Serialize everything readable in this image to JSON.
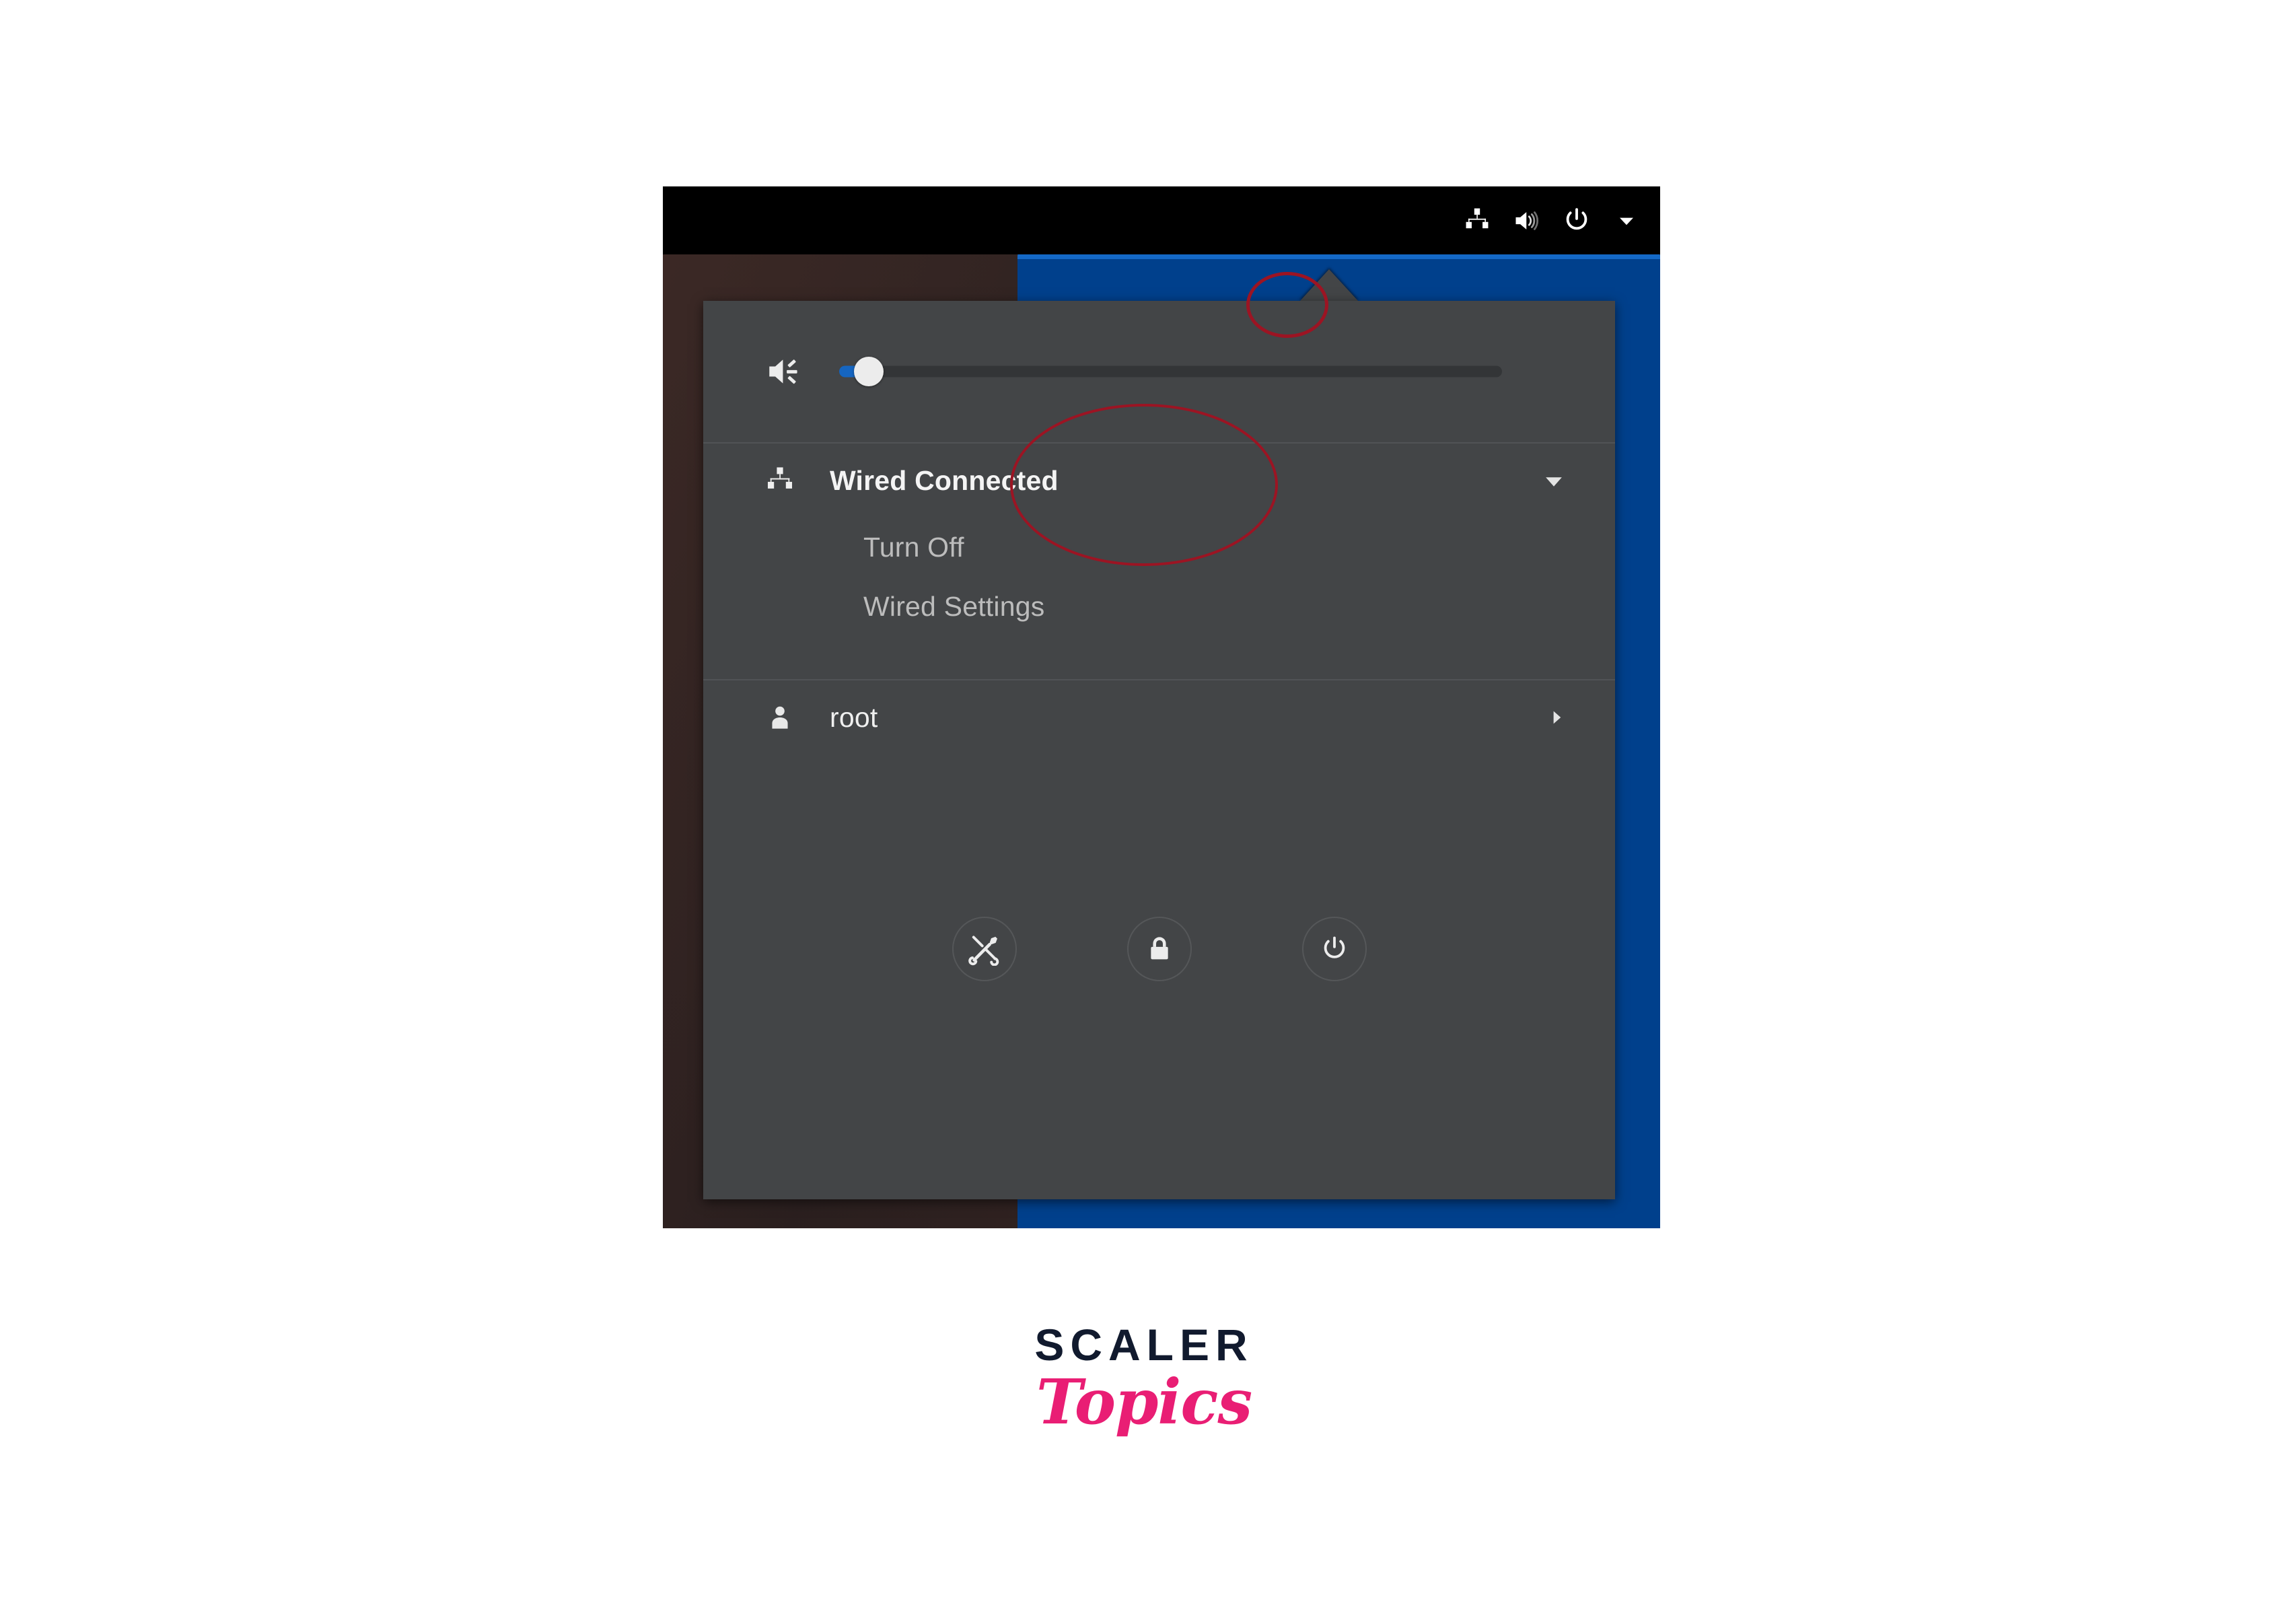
{
  "screenshot": {
    "topbar": {
      "tray_items": [
        {
          "name": "network-wired-icon",
          "label": "Wired network"
        },
        {
          "name": "volume-icon",
          "label": "Volume"
        },
        {
          "name": "power-icon",
          "label": "Power"
        },
        {
          "name": "chevron-down-icon",
          "label": "System menu"
        }
      ]
    },
    "system_menu": {
      "volume": {
        "icon": "volume-low-icon",
        "value": 4,
        "min": 0,
        "max": 100
      },
      "network": {
        "icon": "network-wired-icon",
        "title": "Wired Connected",
        "expander_icon": "chevron-down-icon",
        "expanded": true,
        "items": [
          {
            "label": "Turn Off"
          },
          {
            "label": "Wired Settings"
          }
        ]
      },
      "user": {
        "icon": "user-icon",
        "name": "root",
        "expander_icon": "chevron-right-icon"
      },
      "actions": [
        {
          "name": "settings-button",
          "icon": "tools-icon",
          "label": "Settings"
        },
        {
          "name": "lock-button",
          "icon": "lock-icon",
          "label": "Lock"
        },
        {
          "name": "power-off-button",
          "icon": "power-icon",
          "label": "Power Off"
        }
      ]
    },
    "annotations": [
      {
        "name": "annotation-tray-network",
        "shape": "ellipse",
        "color": "#9c1423"
      },
      {
        "name": "annotation-wired-menu",
        "shape": "ellipse",
        "color": "#9c1423"
      }
    ],
    "colors": {
      "topbar_bg": "#000000",
      "menu_bg": "#434547",
      "desktop_bg": "#2e2322",
      "window_blue": "#00408c",
      "window_titlebar_blue": "#1469c7",
      "slider_fill": "#1565c0",
      "annotation_red": "#9c1423"
    }
  },
  "logo": {
    "primary": "SCALER",
    "secondary": "Topics",
    "primary_color": "#111a2e",
    "secondary_color": "#e91e74"
  }
}
